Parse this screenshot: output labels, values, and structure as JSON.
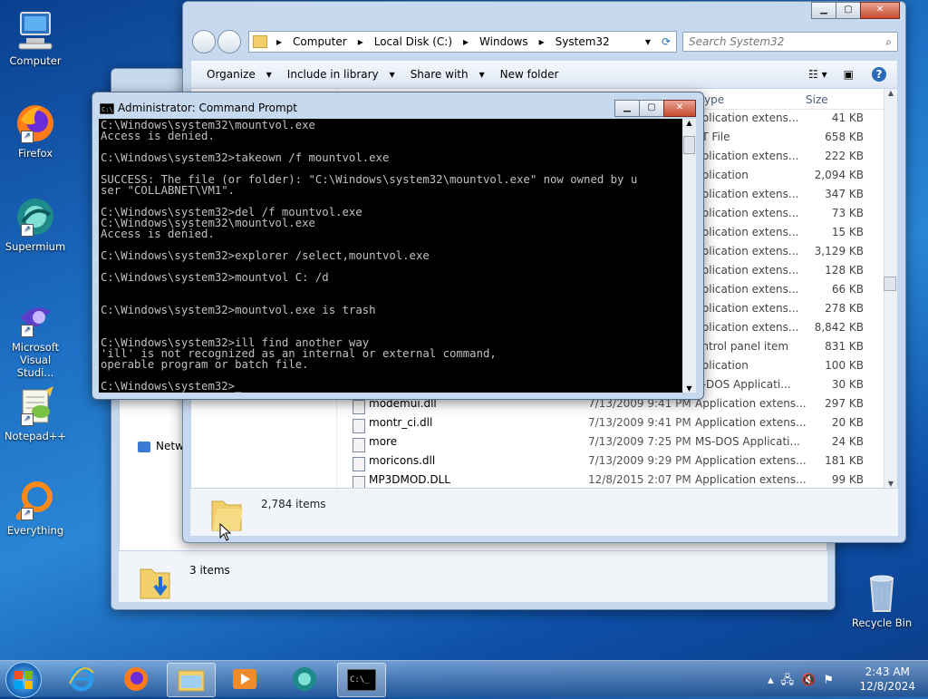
{
  "desktop": {
    "icons": [
      {
        "label": "Computer"
      },
      {
        "label": "Firefox"
      },
      {
        "label": "Supermium"
      },
      {
        "label": "Microsoft Visual Studi..."
      },
      {
        "label": "Notepad++"
      },
      {
        "label": "Everything"
      },
      {
        "label": "Recycle Bin"
      }
    ]
  },
  "explorer": {
    "breadcrumbs": [
      "Computer",
      "Local Disk (C:)",
      "Windows",
      "System32"
    ],
    "search_placeholder": "Search System32",
    "toolbar": {
      "organize": "Organize",
      "include": "Include in library",
      "share": "Share with",
      "newfolder": "New folder"
    },
    "columns": {
      "type": "ype",
      "size": "Size"
    },
    "rows_partial": [
      {
        "type": "pplication extens...",
        "size": "41 KB"
      },
      {
        "type": "AT File",
        "size": "658 KB"
      },
      {
        "type": "pplication extens...",
        "size": "222 KB"
      },
      {
        "type": "pplication",
        "size": "2,094 KB"
      },
      {
        "type": "pplication extens...",
        "size": "347 KB"
      },
      {
        "type": "pplication extens...",
        "size": "73 KB"
      },
      {
        "type": "pplication extens...",
        "size": "15 KB"
      },
      {
        "type": "pplication extens...",
        "size": "3,129 KB"
      },
      {
        "type": "pplication extens...",
        "size": "128 KB"
      },
      {
        "type": "pplication extens...",
        "size": "66 KB"
      },
      {
        "type": "pplication extens...",
        "size": "278 KB"
      },
      {
        "type": "pplication extens...",
        "size": "8,842 KB"
      },
      {
        "type": "ontrol panel item",
        "size": "831 KB"
      },
      {
        "type": "pplication",
        "size": "100 KB"
      },
      {
        "type": "S-DOS Applicati...",
        "size": "30 KB"
      }
    ],
    "rows_full": [
      {
        "name": "modemui.dll",
        "date": "7/13/2009 9:41 PM",
        "type": "Application extens...",
        "size": "297 KB"
      },
      {
        "name": "montr_ci.dll",
        "date": "7/13/2009 9:41 PM",
        "type": "Application extens...",
        "size": "20 KB"
      },
      {
        "name": "more",
        "date": "7/13/2009 7:25 PM",
        "type": "MS-DOS Applicati...",
        "size": "24 KB"
      },
      {
        "name": "moricons.dll",
        "date": "7/13/2009 9:29 PM",
        "type": "Application extens...",
        "size": "181 KB"
      },
      {
        "name": "MP3DMOD.DLL",
        "date": "12/8/2015 2:07 PM",
        "type": "Application extens...",
        "size": "99 KB"
      }
    ],
    "status_items": "2,784 items"
  },
  "explorer2": {
    "nav_network": "Netwo",
    "status_items": "3 items"
  },
  "cmd": {
    "title": "Administrator: Command Prompt",
    "output": "C:\\Windows\\system32\\mountvol.exe\nAccess is denied.\n\nC:\\Windows\\system32>takeown /f mountvol.exe\n\nSUCCESS: The file (or folder): \"C:\\Windows\\system32\\mountvol.exe\" now owned by u\nser \"COLLABNET\\VM1\".\n\nC:\\Windows\\system32>del /f mountvol.exe\nC:\\Windows\\system32\\mountvol.exe\nAccess is denied.\n\nC:\\Windows\\system32>explorer /select,mountvol.exe\n\nC:\\Windows\\system32>mountvol C: /d\n\n\nC:\\Windows\\system32>mountvol.exe is trash\n\n\nC:\\Windows\\system32>ill find another way\n'ill' is not recognized as an internal or external command,\noperable program or batch file.\n\nC:\\Windows\\system32>_"
  },
  "taskbar": {
    "time": "2:43 AM",
    "date": "12/8/2024"
  },
  "colors": {
    "cmd_bg": "#000000",
    "cmd_fg": "#c0c0c0",
    "close_red": "#c74a30"
  }
}
